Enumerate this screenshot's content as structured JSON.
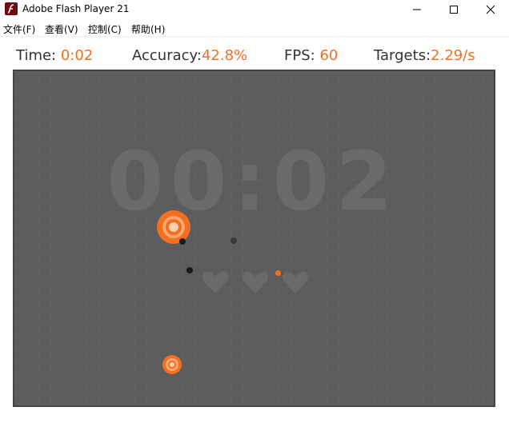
{
  "window": {
    "title": "Adobe Flash Player 21",
    "minimize_icon": "minimize-icon",
    "maximize_icon": "maximize-icon",
    "close_icon": "close-icon"
  },
  "menu": {
    "items": [
      {
        "label": "文件(F)"
      },
      {
        "label": "查看(V)"
      },
      {
        "label": "控制(C)"
      },
      {
        "label": "帮助(H)"
      }
    ]
  },
  "hud": {
    "time_label": "Time:",
    "time_value": "0:02",
    "accuracy_label": "Accuracy:",
    "accuracy_value": "42.8%",
    "fps_label": "FPS:",
    "fps_value": "60",
    "targets_label": "Targets:",
    "targets_value": "2.29/s"
  },
  "game": {
    "countdown": "00:02",
    "lives": 3,
    "colors": {
      "background": "#5c5c5c",
      "accent": "#f26f21",
      "target_light": "#f9a770"
    }
  }
}
